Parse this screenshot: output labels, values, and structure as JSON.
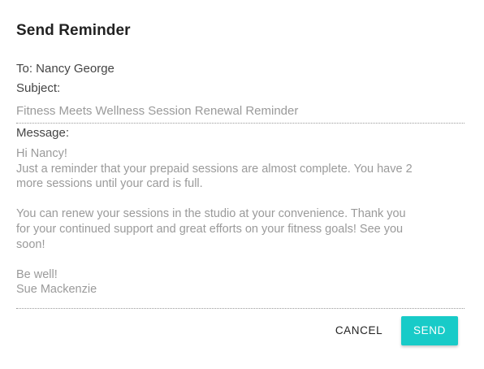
{
  "dialog": {
    "title": "Send Reminder",
    "to_line": "To: Nancy George",
    "subject_label": "Subject:",
    "subject_value": "Fitness Meets Wellness Session Renewal Reminder",
    "message_label": "Message:",
    "message_lines": [
      "Hi Nancy!",
      "Just a reminder that your prepaid sessions are almost complete. You have 2",
      "more sessions until your card is full.",
      "",
      "You can renew your sessions in the studio  at your convenience. Thank you",
      "for your continued support and great efforts on your fitness goals! See you",
      "soon!",
      "",
      "Be well!",
      "Sue Mackenzie"
    ],
    "cancel_label": "CANCEL",
    "send_label": "SEND"
  },
  "colors": {
    "accent": "#18cbc8",
    "muted_text": "#9a9a9a",
    "label_text": "#444444"
  }
}
